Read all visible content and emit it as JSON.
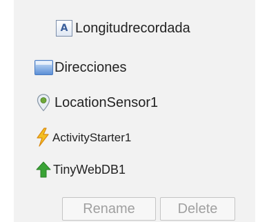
{
  "components": [
    {
      "icon": "label-icon",
      "label": "Longitudrecordada"
    },
    {
      "icon": "arrangement-icon",
      "label": "Direcciones"
    },
    {
      "icon": "location-pin-icon",
      "label": "LocationSensor1"
    },
    {
      "icon": "lightning-bolt-icon",
      "label": "ActivityStarter1"
    },
    {
      "icon": "green-up-arrow-icon",
      "label": "TinyWebDB1"
    }
  ],
  "actions": {
    "rename_label": "Rename",
    "delete_label": "Delete"
  },
  "colors": {
    "panel_background": "#f2f2f2",
    "button_text": "#a0a0a0",
    "text": "#222222",
    "arrow_green": "#3aa336",
    "bolt_yellow": "#f4c022",
    "pin_green": "#6fa83a"
  }
}
